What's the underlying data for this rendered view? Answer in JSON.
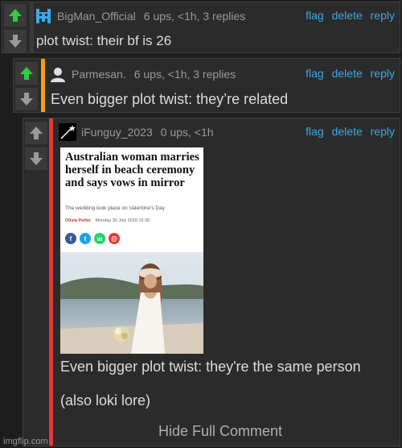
{
  "actions": {
    "flag": "flag",
    "delete": "delete",
    "reply": "reply"
  },
  "comments": [
    {
      "username": "BigMan_Official",
      "meta": "6 ups, <1h, 3 replies",
      "text": "plot twist: their bf is 26",
      "avatar_icon": "pixel-invader-icon",
      "bar_color": "#3a3a3a"
    },
    {
      "username": "Parmesan.",
      "meta": "6 ups, <1h, 3 replies",
      "text": "Even bigger plot twist: they’re related",
      "avatar_icon": "user-silhouette-icon",
      "bar_color": "#f39c12"
    },
    {
      "username": "iFunguy_2023",
      "meta": "0 ups, <1h",
      "text": "Even bigger plot twist: they're the same person",
      "text2": "(also loki lore)",
      "avatar_icon": "star-streak-icon",
      "bar_color": "#e53935",
      "article": {
        "title": "Australian woman marries herself in beach ceremony and says vows in mirror",
        "subtitle": "The wedding took place on Valentine's Day",
        "author": "Olivia Petter",
        "date": "Monday 30 July 2018 16:30"
      },
      "hide_label": "Hide Full Comment"
    }
  ],
  "watermark": "imgflip.com",
  "colors": {
    "upvote": "#2ecc40",
    "downvote": "#9a9a9a",
    "link": "#3aa9e8"
  }
}
